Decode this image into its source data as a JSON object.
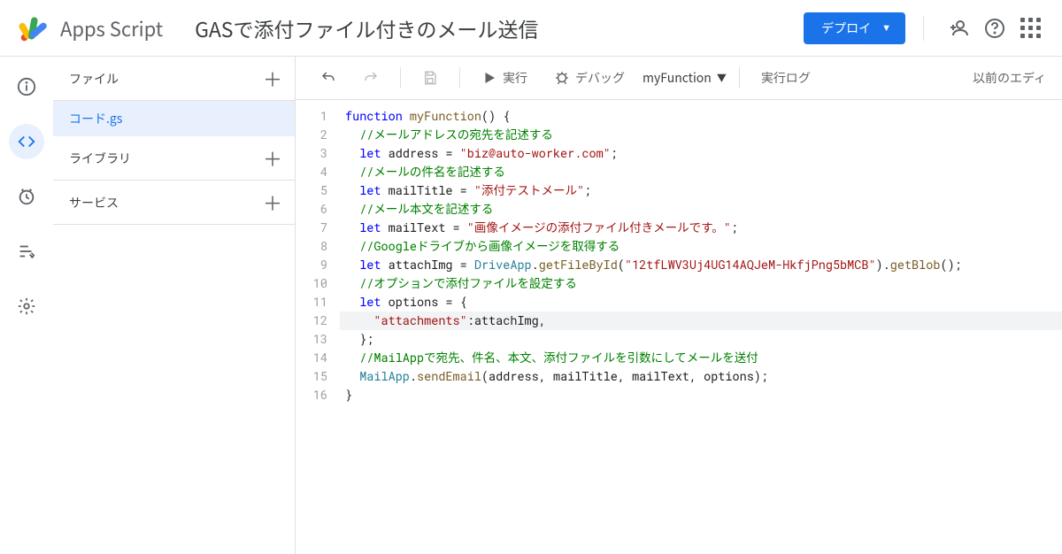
{
  "header": {
    "brand": "Apps Script",
    "title": "GASで添付ファイル付きのメール送信",
    "deploy_label": "デプロイ"
  },
  "sidebar": {
    "files_label": "ファイル",
    "library_label": "ライブラリ",
    "services_label": "サービス",
    "file_name": "コード.gs"
  },
  "toolbar": {
    "run_label": "実行",
    "debug_label": "デバッグ",
    "function_name": "myFunction",
    "log_label": "実行ログ",
    "legacy_label": "以前のエディ"
  },
  "code": {
    "lines": [
      {
        "n": 1,
        "t": "function",
        "html": true
      },
      {
        "n": 2,
        "t": "//メールアドレスの宛先を記述する"
      },
      {
        "n": 3,
        "t": "let address = \"biz@auto-worker.com\";"
      },
      {
        "n": 4,
        "t": "//メールの件名を記述する"
      },
      {
        "n": 5,
        "t": "let mailTitle = \"添付テストメール\";"
      },
      {
        "n": 6,
        "t": "//メール本文を記述する"
      },
      {
        "n": 7,
        "t": "let mailText = \"画像イメージの添付ファイル付きメールです。\";"
      },
      {
        "n": 8,
        "t": "//Googleドライブから画像イメージを取得する"
      },
      {
        "n": 9,
        "t": "let attachImg = DriveApp.getFileById(\"12tfLWV3Uj4UG14AQJeM-HkfjPng5bMCB\").getBlob();"
      },
      {
        "n": 10,
        "t": "//オプションで添付ファイルを設定する"
      },
      {
        "n": 11,
        "t": "let options = {"
      },
      {
        "n": 12,
        "t": "\"attachments\":attachImg,"
      },
      {
        "n": 13,
        "t": "};"
      },
      {
        "n": 14,
        "t": "//MailAppで宛先、件名、本文、添付ファイルを引数にしてメールを送付"
      },
      {
        "n": 15,
        "t": "MailApp.sendEmail(address, mailTitle, mailText, options);"
      },
      {
        "n": 16,
        "t": "}"
      }
    ],
    "current_line": 12,
    "strings": {
      "email": "biz@auto-worker.com",
      "title": "添付テストメール",
      "body": "画像イメージの添付ファイル付きメールです。",
      "file_id": "12tfLWV3Uj4UG14AQJeM-HkfjPng5bMCB",
      "attach_key": "attachments"
    }
  }
}
